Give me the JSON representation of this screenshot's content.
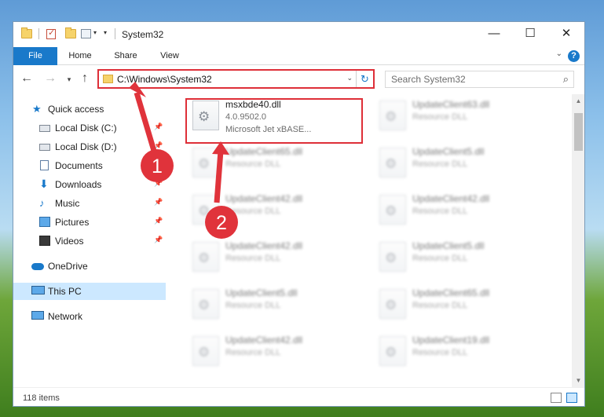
{
  "window": {
    "title": "System32",
    "minimize_icon": "minimize-icon",
    "maximize_icon": "maximize-icon",
    "close_icon": "close-icon"
  },
  "ribbon": {
    "tabs": [
      "File",
      "Home",
      "Share",
      "View"
    ],
    "help": "?"
  },
  "navigation": {
    "address_path": "C:\\Windows\\System32",
    "search_placeholder": "Search System32"
  },
  "sidebar": {
    "items": [
      {
        "label": "Quick access",
        "icon": "star-icon"
      },
      {
        "label": "Local Disk (C:)",
        "icon": "disk-icon"
      },
      {
        "label": "Local Disk (D:)",
        "icon": "disk-icon"
      },
      {
        "label": "Documents",
        "icon": "documents-icon"
      },
      {
        "label": "Downloads",
        "icon": "downloads-icon"
      },
      {
        "label": "Music",
        "icon": "music-icon"
      },
      {
        "label": "Pictures",
        "icon": "pictures-icon"
      },
      {
        "label": "Videos",
        "icon": "videos-icon"
      },
      {
        "label": "OneDrive",
        "icon": "cloud-icon"
      },
      {
        "label": "This PC",
        "icon": "computer-icon"
      },
      {
        "label": "Network",
        "icon": "network-icon"
      }
    ]
  },
  "files": {
    "highlighted": {
      "name": "msxbde40.dll",
      "version": "4.0.9502.0",
      "description": "Microsoft Jet xBASE..."
    },
    "left_column": [
      {
        "name": "UpdateClient65.dll",
        "desc": "Resource DLL"
      },
      {
        "name": "UpdateClient42.dll",
        "desc": "Resource DLL"
      },
      {
        "name": "UpdateClient42.dll",
        "desc": "Resource DLL"
      },
      {
        "name": "UpdateClient5.dll",
        "desc": "Resource DLL"
      },
      {
        "name": "UpdateClient42.dll",
        "desc": "Resource DLL"
      }
    ],
    "right_column": [
      {
        "name": "UpdateClient63.dll",
        "desc": "Resource DLL"
      },
      {
        "name": "UpdateClient5.dll",
        "desc": "Resource DLL"
      },
      {
        "name": "UpdateClient42.dll",
        "desc": "Resource DLL"
      },
      {
        "name": "UpdateClient5.dll",
        "desc": "Resource DLL"
      },
      {
        "name": "UpdateClient65.dll",
        "desc": "Resource DLL"
      },
      {
        "name": "UpdateClient19.dll",
        "desc": "Resource DLL"
      }
    ]
  },
  "status": {
    "item_count": "118 items"
  },
  "annotations": {
    "step1": "1",
    "step2": "2",
    "highlight_color": "#de2f38"
  }
}
